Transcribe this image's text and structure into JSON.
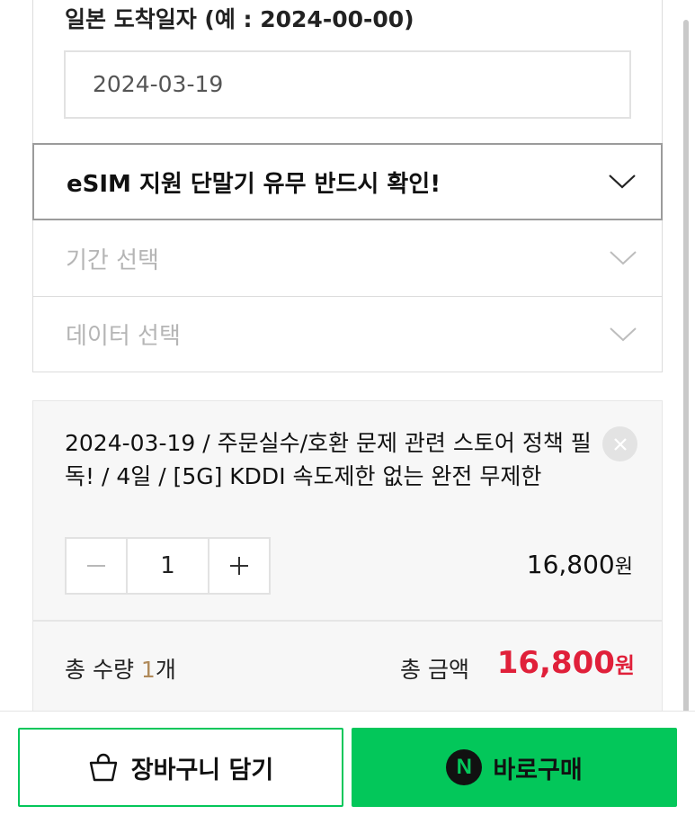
{
  "arrival": {
    "label": "일본 도착일자 (예 : 2024-00-00)",
    "value": "2024-03-19"
  },
  "options": [
    {
      "label": "eSIM 지원 단말기 유무 반드시 확인!",
      "icon": "chevron-down-icon"
    },
    {
      "label": "기간 선택",
      "icon": "chevron-down-icon"
    },
    {
      "label": "데이터 선택",
      "icon": "chevron-down-icon"
    }
  ],
  "item": {
    "description": "2024-03-19 / 주문실수/호환 문제 관련 스토어 정책 필독! / 4일 / [5G] KDDI 속도제한 없는 완전 무제한",
    "quantity": "1",
    "price": "16,800",
    "price_unit": "원",
    "remove_icon": "close-icon",
    "minus_icon": "minus-icon",
    "plus_icon": "plus-icon"
  },
  "summary": {
    "qty_label": "총 수량 ",
    "qty_value": "1",
    "qty_unit": "개",
    "amount_label": "총 금액",
    "amount_value": "16,800",
    "amount_unit": "원",
    "amount_color": "#e0203a"
  },
  "actions": {
    "cart_label": "장바구니 담기",
    "cart_icon": "shopping-bag-icon",
    "buy_label": "바로구매",
    "buy_icon": "naver-pay-icon",
    "buy_icon_glyph": "N",
    "accent_color": "#03c75a"
  }
}
